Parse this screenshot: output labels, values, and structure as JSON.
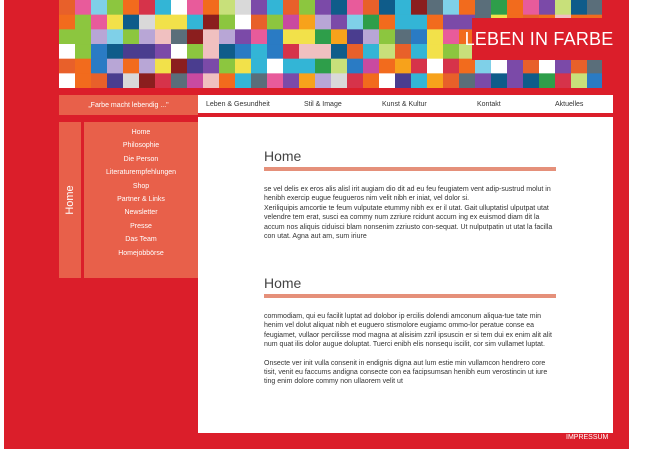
{
  "brand": {
    "title": "LEBEN IN FARBE"
  },
  "nav": {
    "tagline": "„Farbe macht lebendig ...\"",
    "tabs": [
      {
        "label": "Leben & Gesundheit"
      },
      {
        "label": "Stil & Image"
      },
      {
        "label": "Kunst & Kultur"
      },
      {
        "label": "Kontakt"
      },
      {
        "label": "Aktuelles"
      }
    ]
  },
  "sidebar": {
    "section_title": "Home",
    "items": [
      {
        "label": "Home"
      },
      {
        "label": "Philosophie"
      },
      {
        "label": "Die Person"
      },
      {
        "label": "Literaturempfehlungen"
      },
      {
        "label": "Shop"
      },
      {
        "label": "Partner & Links"
      },
      {
        "label": "Newsletter"
      },
      {
        "label": "Presse"
      },
      {
        "label": "Das Team"
      },
      {
        "label": "Homejobbörse"
      }
    ]
  },
  "content": {
    "sections": [
      {
        "heading": "Home",
        "paragraphs": [
          "se vel delis ex eros alis alisl irit augiam dio dit ad eu feu feugiatem vent adip-sustrud molut in henibh exercip eugue feugueros nim velit nibh er iniat, vel dolor si.",
          "Xeriliquipis amcortie te feum vulputate etummy nibh ex er il utat. Gait ulluptatisl ulputpat utat velendre tem erat, susci ea commy num zzriure rcidunt accum ing ex euismod diam dit la accum nos aliquis ciduisci blam nonsenim zzriusto con-sequat. Ut nulputpatin ut utat la facilla con utat. Agna aut am, sum iriure"
        ]
      },
      {
        "heading": "Home",
        "paragraphs": [
          "commodiam, qui eu facilit luptat ad dolobor ip ercilis dolendi amconum aliqua-tue tate min henim vel dolut aliquat nibh et euguero stismolore eugiamc ommo-lor peratue conse ea feugiamet, vullaor percilisse mod magna at alisisim zzril ipsuscin er si tem dui ex enim alit alit num quat ilis dolor augue doluptat. Tuerci enibh elis nonsequ iscilit, cor sim vullamet luptat.",
          "Onsecte ver init vulla consenit in endignis digna aut lum estie min vullamcon hendrero core tisit, venit eu faccums andigna consecte con ea facipsumsan henibh eum verostincin ut iure ting enim dolore commy non ullaorem velit ut"
        ]
      }
    ]
  },
  "footer": {
    "impressum": "IMPRESSUM"
  },
  "colors": {
    "brand_red": "#db1e2a",
    "nav_orange": "#e8604a",
    "heading_rule": "#e5907a",
    "mosaic_palette": [
      "#2a7bc4",
      "#33b5d6",
      "#7fd0e8",
      "#0f5c8a",
      "#2e9e4a",
      "#8cc63f",
      "#c8e07a",
      "#f2e14a",
      "#f7a21b",
      "#f26b1d",
      "#e8602a",
      "#d6334a",
      "#e85b9b",
      "#c94aa0",
      "#7b4aa8",
      "#4a3d8f",
      "#b8a6d6",
      "#d9d9d9",
      "#f0c0c0",
      "#ffffff",
      "#8b1e1e",
      "#5a6e7a"
    ]
  }
}
